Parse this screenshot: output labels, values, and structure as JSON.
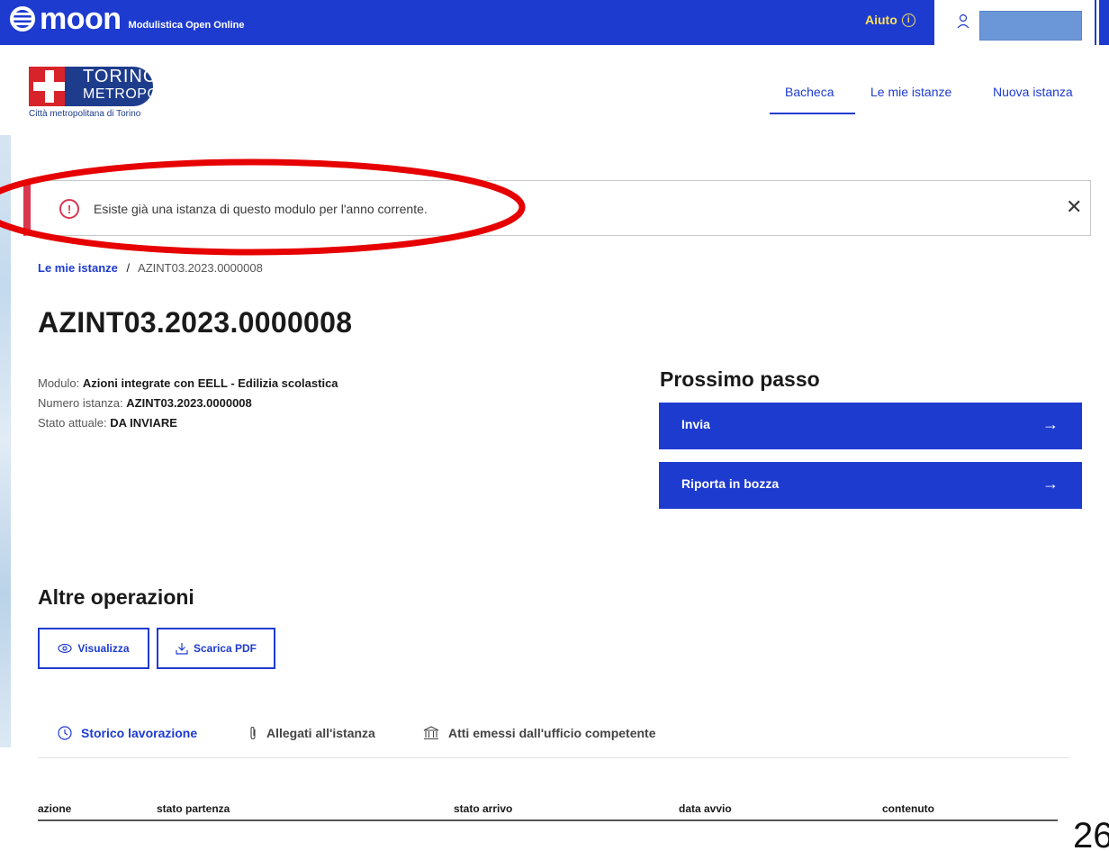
{
  "topbar": {
    "brand_name": "moon",
    "brand_sub": "Modulistica Open Online",
    "help_label": "Aiuto",
    "user_name": ""
  },
  "header": {
    "logo_line1": "TORINO",
    "logo_line2": "METROPOLI",
    "logo_caption": "Città metropolitana di Torino",
    "nav": [
      "Bacheca",
      "Le mie istanze",
      "Nuova istanza"
    ],
    "nav_active": "Bacheca"
  },
  "alert": {
    "message": "Esiste già una istanza di questo modulo per l'anno corrente."
  },
  "breadcrumb": {
    "link": "Le mie istanze",
    "separator": "/",
    "current": "AZINT03.2023.0000008"
  },
  "page_title": "AZINT03.2023.0000008",
  "meta": {
    "modulo_label": "Modulo:",
    "modulo_value": "Azioni integrate con EELL - Edilizia scolastica",
    "numero_label": "Numero istanza:",
    "numero_value": "AZINT03.2023.0000008",
    "stato_label": "Stato attuale:",
    "stato_value": "DA INVIARE"
  },
  "next_step": {
    "title": "Prossimo passo",
    "buttons": [
      "Invia",
      "Riporta in bozza"
    ]
  },
  "other_ops": {
    "title": "Altre operazioni",
    "view_label": "Visualizza",
    "pdf_label": "Scarica PDF"
  },
  "tabs": [
    "Storico lavorazione",
    "Allegati all'istanza",
    "Atti emessi dall'ufficio competente"
  ],
  "table_headers": [
    "azione",
    "stato partenza",
    "stato arrivo",
    "data avvio",
    "contenuto"
  ],
  "corner_text": "26",
  "colors": {
    "primary": "#1e3bd0",
    "help": "#f8e15a",
    "alert_accent": "#d9364f",
    "annotation": "#e60000"
  },
  "icons": {
    "help": "info-circle-icon",
    "user": "user-icon",
    "alert": "exclamation-circle-icon",
    "close": "close-icon",
    "arrow": "arrow-right-icon",
    "view": "eye-icon",
    "pdf": "download-icon",
    "history": "clock-icon",
    "attachments": "paperclip-icon",
    "documents": "institution-icon"
  }
}
